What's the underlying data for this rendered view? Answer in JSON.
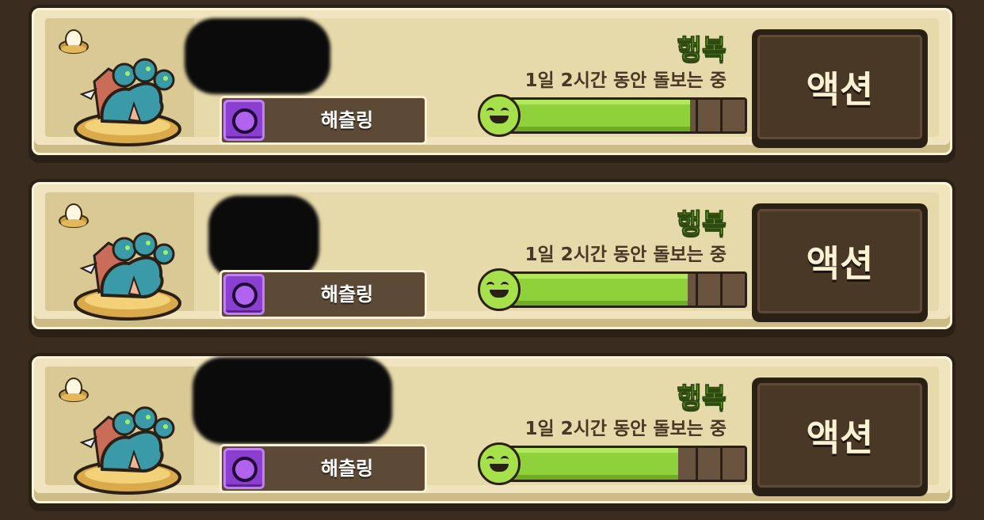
{
  "cards": [
    {
      "mood": "행복",
      "care_status": "1일 2시간 동안 돌보는 중",
      "pet_name": "해츨링",
      "happiness": 0.78,
      "action_label": "액션"
    },
    {
      "mood": "행복",
      "care_status": "1일 2시간 동안 돌보는 중",
      "pet_name": "해츨링",
      "happiness": 0.77,
      "action_label": "액션"
    },
    {
      "mood": "행복",
      "care_status": "1일 2시간 동안 돌보는 중",
      "pet_name": "해츨링",
      "happiness": 0.73,
      "action_label": "액션"
    }
  ],
  "colors": {
    "mood_green": "#8fd13a",
    "gem_purple": "#8a3fd1",
    "panel_cream": "#efe4bd",
    "dark_brown": "#2b2015"
  },
  "icons": {
    "egg": "egg-nest-icon",
    "pet": "hydra-dragon-sprite",
    "gem": "purple-gem-icon",
    "face": "smiley-face-icon"
  }
}
